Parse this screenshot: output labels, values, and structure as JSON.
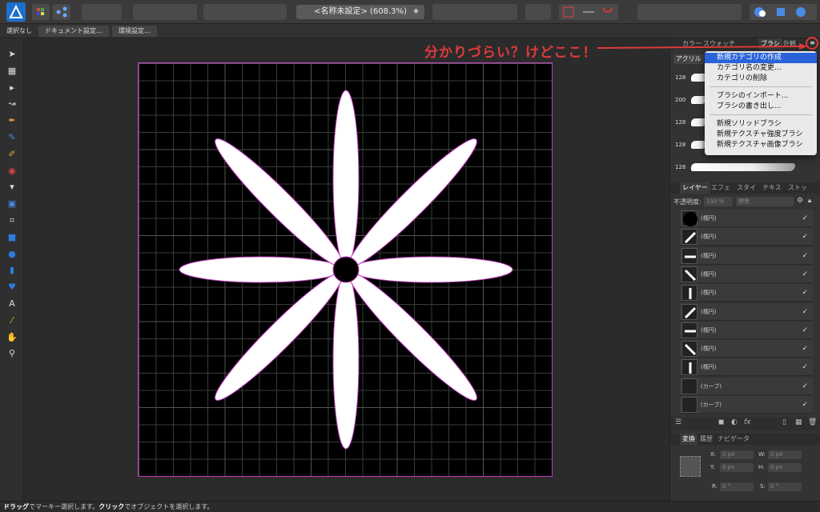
{
  "toolbar": {
    "document_title": "<名称未設定> (608.3%)",
    "star": "★"
  },
  "contextbar": {
    "selection": "選択なし",
    "document_settings": "ドキュメント設定...",
    "preferences": "環境設定..."
  },
  "tools": [
    "move-tool-icon",
    "artboard-tool-icon",
    "node-tool-icon",
    "corner-tool-icon",
    "pen-tool-icon",
    "pencil-tool-icon",
    "vector-brush-icon",
    "fill-tool-icon",
    "transparency-tool-icon",
    "place-image-icon",
    "crop-tool-icon",
    "rectangle-tool-icon",
    "ellipse-tool-icon",
    "rounded-rect-icon",
    "heart-shape-icon",
    "text-tool-icon",
    "color-picker-icon",
    "hand-tool-icon",
    "zoom-tool-icon"
  ],
  "tool_glyphs": [
    "➤",
    "▦",
    "▸",
    "↝",
    "✒",
    "✎",
    "✐",
    "◉",
    "▾",
    "▣",
    "⌗",
    "■",
    "●",
    "▮",
    "♥",
    "A",
    "⁄",
    "✋",
    "⚲"
  ],
  "annotation": {
    "text": "分かりづらい？けどここ！",
    "color": "#e03a3a"
  },
  "brush_panel": {
    "tabs": [
      "カラー",
      "スウォッチ",
      "ブラシ",
      "外観"
    ],
    "active_tab": "ブラシ",
    "category": "アクリル",
    "brushes": [
      {
        "size": "128"
      },
      {
        "size": "200"
      },
      {
        "size": "128"
      },
      {
        "size": "128"
      },
      {
        "size": "128"
      }
    ]
  },
  "menu": {
    "items": [
      {
        "label": "新規カテゴリの作成",
        "selected": true
      },
      {
        "label": "カテゴリ名の変更..."
      },
      {
        "label": "カテゴリの削除"
      },
      {
        "label": "ブラシのインポート..."
      },
      {
        "label": "ブラシの書き出し..."
      },
      {
        "label": "新規ソリッドブラシ"
      },
      {
        "label": "新規テクスチャ強度ブラシ"
      },
      {
        "label": "新規テクスチャ画像ブラシ"
      }
    ],
    "highlight_color": "#2a62d9"
  },
  "layers_panel": {
    "tabs": [
      "レイヤー",
      "エフェ",
      "スタイ",
      "テキス",
      "ストッ"
    ],
    "active_tab": "レイヤー",
    "opacity_label": "不透明度:",
    "opacity_value": "100 %",
    "blend_mode": "標準",
    "layers": [
      {
        "name": "(楕円)",
        "checked": "✓"
      },
      {
        "name": "(楕円)",
        "checked": "✓"
      },
      {
        "name": "(楕円)",
        "checked": "✓"
      },
      {
        "name": "(楕円)",
        "checked": "✓"
      },
      {
        "name": "(楕円)",
        "checked": "✓"
      },
      {
        "name": "(楕円)",
        "checked": "✓"
      },
      {
        "name": "(楕円)",
        "checked": "✓"
      },
      {
        "name": "(楕円)",
        "checked": "✓"
      },
      {
        "name": "(楕円)",
        "checked": "✓"
      },
      {
        "name": "(カーブ)",
        "checked": "✓"
      },
      {
        "name": "(カーブ)",
        "checked": "✓"
      }
    ]
  },
  "transform_panel": {
    "tabs": [
      "変換",
      "履歴",
      "ナビゲータ"
    ],
    "active_tab": "変換",
    "x_label": "X:",
    "x_value": "0 px",
    "y_label": "Y:",
    "y_value": "0 px",
    "w_label": "W:",
    "w_value": "0 px",
    "h_label": "H:",
    "h_value": "0 px",
    "r_label": "R:",
    "r_value": "0 °",
    "s_label": "S:",
    "s_value": "0 °"
  },
  "statusbar": {
    "drag_bold": "ドラッグ",
    "drag_text": "でマーキー選択します。",
    "click_bold": "クリック",
    "click_text": "でオブジェクトを選択します。"
  }
}
